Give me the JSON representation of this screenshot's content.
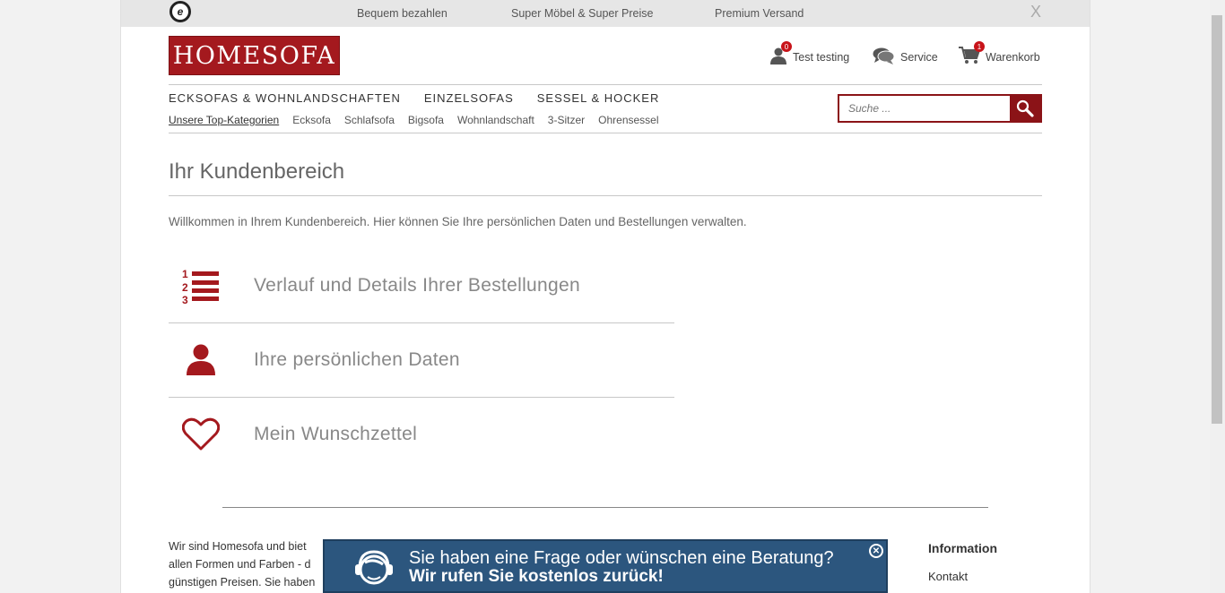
{
  "topbar": {
    "badge": "e",
    "items": [
      "Bequem bezahlen",
      "Super Möbel & Super Preise",
      "Premium Versand"
    ],
    "close": "X"
  },
  "header": {
    "logo": "HOMESOFA",
    "account": {
      "label": "Test testing",
      "count": "0"
    },
    "service": {
      "label": "Service"
    },
    "cart": {
      "label": "Warenkorb",
      "count": "1"
    }
  },
  "nav": {
    "main": [
      "Ecksofas & Wohnlandschaften",
      "Einzelsofas",
      "Sessel & Hocker"
    ],
    "sub": [
      "Unsere Top-Kategorien",
      "Ecksofa",
      "Schlafsofa",
      "Bigsofa",
      "Wohnlandschaft",
      "3-Sitzer",
      "Ohrensessel"
    ]
  },
  "search": {
    "placeholder": "Suche ..."
  },
  "main": {
    "title": "Ihr Kundenbereich",
    "intro": "Willkommen in Ihrem Kundenbereich. Hier können Sie Ihre persönlichen Daten und Bestellungen verwalten.",
    "items": [
      {
        "label": "Verlauf und Details Ihrer Bestellungen",
        "icon": "ordered-list-icon"
      },
      {
        "label": "Ihre persönlichen Daten",
        "icon": "user-icon"
      },
      {
        "label": "Mein Wunschzettel",
        "icon": "heart-icon"
      }
    ]
  },
  "footer": {
    "lines": [
      "Wir sind Homesofa und biet",
      "allen Formen und Farben - d",
      "günstigen Preisen. Sie haben"
    ],
    "info_heading": "Information",
    "kontakt": "Kontakt"
  },
  "callback": {
    "line1": "Sie haben eine Frage oder wünschen eine Beratung?",
    "line2": "Wir rufen Sie kostenlos zurück!"
  },
  "colors": {
    "brand": "#a4191e",
    "callback": "#2c567e"
  }
}
